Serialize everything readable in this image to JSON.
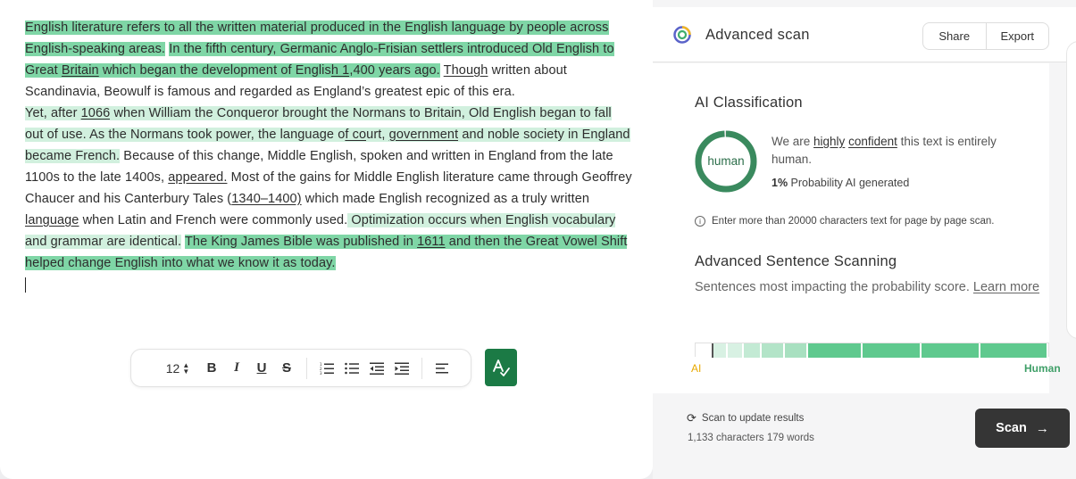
{
  "editor": {
    "paragraphs": [
      [
        {
          "t": "English literature refers to all the written material produced in the English language by people across English-speaking areas.",
          "hl": "strong"
        },
        {
          "t": " ",
          "hl": ""
        },
        {
          "t": "In the fifth century, Germanic Anglo-Frisian settlers introduced Old English to Great ",
          "hl": "strong"
        },
        {
          "t": "Britain",
          "hl": "strong",
          "u": true
        },
        {
          "t": " which began the development of Englis",
          "hl": "strong"
        },
        {
          "t": "h 1",
          "hl": "strong",
          "u": true
        },
        {
          "t": ",400 years ago.",
          "hl": "strong"
        },
        {
          "t": " ",
          "hl": ""
        },
        {
          "t": "Though",
          "hl": "",
          "u": true
        },
        {
          "t": " written about Scandinavia, Beowulf is famous and regarded as England’s greatest epic of this era.",
          "hl": ""
        }
      ],
      [
        {
          "t": "Yet, after ",
          "hl": "light"
        },
        {
          "t": "1066",
          "hl": "light",
          "u": true
        },
        {
          "t": " when William the Conqueror brought the Normans to Britain, Old English began to fall out of use.",
          "hl": "light"
        },
        {
          "t": " As the Normans took power, the language o",
          "hl": "light"
        },
        {
          "t": "f co",
          "hl": "light",
          "u": true
        },
        {
          "t": "urt, ",
          "hl": "light"
        },
        {
          "t": "government",
          "hl": "light",
          "u": true
        },
        {
          "t": " and noble society in England became French.",
          "hl": "light"
        },
        {
          "t": " Because of this change, Middle English, spoken and written in England from the late 1100s to the late 1400s, ",
          "hl": ""
        },
        {
          "t": "appeared.",
          "hl": "",
          "u": true
        },
        {
          "t": " Most of the gains for Middle English literature came through Geoffrey Chaucer and his Canterbury Tales (",
          "hl": ""
        },
        {
          "t": "1340–1400)",
          "hl": "",
          "u": true
        },
        {
          "t": " which made English recognized as a truly written ",
          "hl": ""
        },
        {
          "t": "language",
          "hl": "",
          "u": true
        },
        {
          "t": " when Latin and French were commonly used.",
          "hl": ""
        },
        {
          "t": " Optimization occurs when English vocabulary and grammar are identical.",
          "hl": "light"
        },
        {
          "t": " ",
          "hl": ""
        },
        {
          "t": "The King James Bible was published in ",
          "hl": "strong"
        },
        {
          "t": "1611",
          "hl": "strong",
          "u": true
        },
        {
          "t": " and then the Great Vowel Shift helped change English into what we know it as today.",
          "hl": "strong"
        }
      ]
    ],
    "toolbar": {
      "font_size": "12",
      "bold": "B",
      "italic": "I",
      "underline": "U",
      "strike": "S"
    }
  },
  "panel": {
    "title": "Advanced scan",
    "share_label": "Share",
    "export_label": "Export",
    "ai_class_title": "AI Classification",
    "donut_label": "human",
    "human_fraction": 0.99,
    "verdict_pre": "We are ",
    "verdict_highly": "highly",
    "verdict_confident": "confident",
    "verdict_post": " this text is entirely human.",
    "prob_value": "1%",
    "prob_text": " Probability AI generated",
    "info_text": "Enter more than 20000 characters text for page by page scan.",
    "adv_title": "Advanced Sentence Scanning",
    "adv_sub": "Sentences most impacting the probability score. ",
    "learn_more": "Learn more",
    "bar_ai": "AI",
    "bar_human": "Human",
    "bar_segments": [
      {
        "w": 20,
        "c": "#ffffff"
      },
      {
        "w": 16,
        "c": "#d8f1e3"
      },
      {
        "w": 18,
        "c": "#d8f1e3"
      },
      {
        "w": 20,
        "c": "#c3ead4"
      },
      {
        "w": 26,
        "c": "#b3e4c8"
      },
      {
        "w": 26,
        "c": "#a8e0c0"
      },
      {
        "w": 61,
        "c": "#5fc98e"
      },
      {
        "w": 66,
        "c": "#5fc98e"
      },
      {
        "w": 66,
        "c": "#5fc98e"
      },
      {
        "w": 76,
        "c": "#5fc98e"
      }
    ],
    "colors": {
      "accent": "#1b7a45",
      "donut": "#3a8a5e",
      "scan_btn": "#353535"
    }
  },
  "footer": {
    "status": "Scan to update results",
    "count": "1,133 characters 179 words",
    "scan_label": "Scan"
  }
}
